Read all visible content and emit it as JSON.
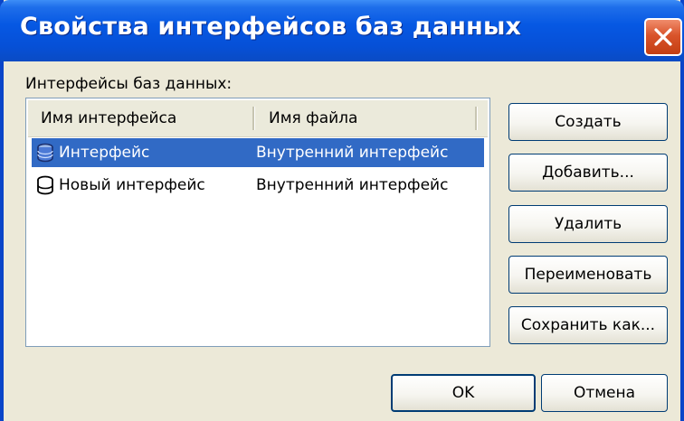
{
  "window": {
    "title": "Свойства интерфейсов баз данных",
    "close_icon": "close-icon"
  },
  "list": {
    "label": "Интерфейсы баз данных:",
    "columns": [
      "Имя интерфейса",
      "Имя файла"
    ],
    "rows": [
      {
        "name": "Интерфейс",
        "file": "Внутренний интерфейс",
        "selected": true,
        "icon": "database-icon"
      },
      {
        "name": "Новый интерфейс",
        "file": "Внутренний интерфейс",
        "selected": false,
        "icon": "database-icon"
      }
    ]
  },
  "buttons": {
    "create": "Создать",
    "add": "Добавить...",
    "delete": "Удалить",
    "rename": "Переименовать",
    "save_as": "Сохранить как...",
    "ok": "OK",
    "cancel": "Отмена"
  },
  "colors": {
    "titlebar": "#0658E3",
    "selection": "#316AC5",
    "close_button": "#D9542B",
    "dialog_background": "#ECE9D8"
  }
}
